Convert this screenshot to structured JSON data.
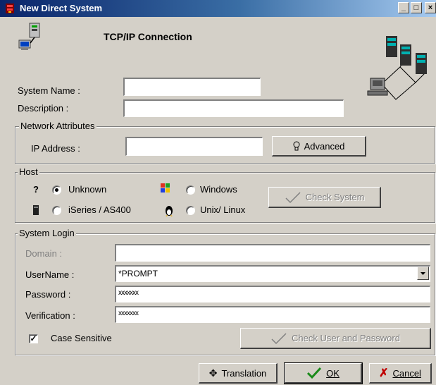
{
  "window": {
    "title": "New Direct System",
    "minimize_glyph": "_",
    "maximize_glyph": "□",
    "close_glyph": "×"
  },
  "header": {
    "title": "TCP/IP Connection"
  },
  "fields": {
    "system_name_label": "System Name :",
    "system_name_value": "",
    "description_label": "Description :",
    "description_value": ""
  },
  "network": {
    "legend": "Network Attributes",
    "ip_label": "IP Address :",
    "ip_value": "",
    "advanced_label": "Advanced"
  },
  "host": {
    "legend": "Host",
    "unknown_mark": "?",
    "options": [
      {
        "label": "Unknown",
        "selected": true
      },
      {
        "label": "Windows",
        "selected": false
      },
      {
        "label": "iSeries / AS400",
        "selected": false
      },
      {
        "label": "Unix/ Linux",
        "selected": false
      }
    ],
    "check_system_label": "Check System"
  },
  "login": {
    "legend": "System Login",
    "domain_label": "Domain :",
    "domain_value": "",
    "username_label": "UserName :",
    "username_value": "*PROMPT",
    "password_label": "Password :",
    "password_value": "xxxxxxx",
    "verification_label": "Verification :",
    "verification_value": "xxxxxxx",
    "case_sensitive_label": "Case Sensitive",
    "case_sensitive_checked": true,
    "check_user_label": "Check User and Password"
  },
  "footer": {
    "translation_label": "Translation",
    "ok_label": "OK",
    "cancel_label": "Cancel"
  },
  "colors": {
    "titlebar_start": "#0a246a",
    "titlebar_end": "#a6caf0",
    "face": "#d4d0c8",
    "ok_check": "#1a8a1a",
    "cancel_x": "#c00000"
  }
}
